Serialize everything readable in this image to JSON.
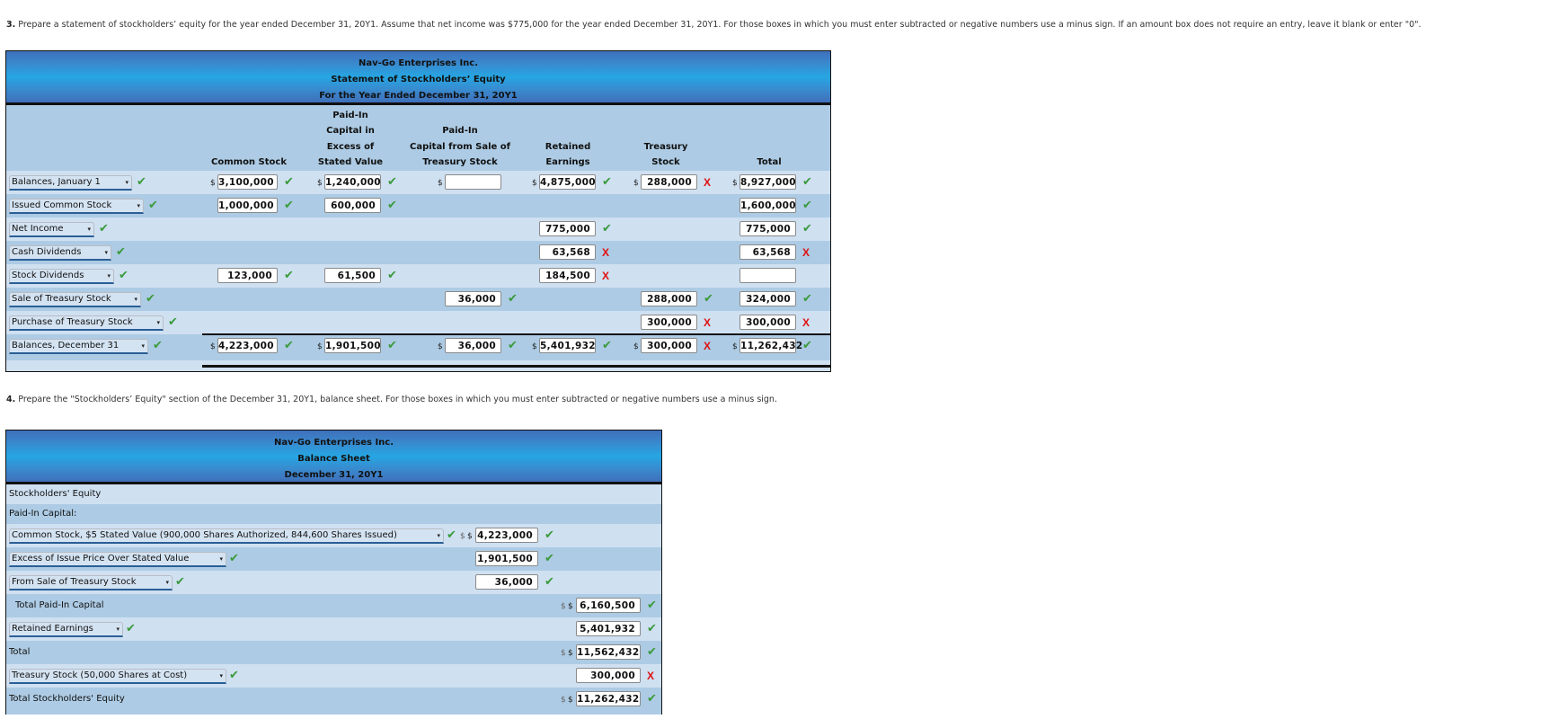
{
  "question3": {
    "number": "3.",
    "text": "Prepare a statement of stockholders’ equity for the year ended December 31, 20Y1. Assume that net income was $775,000 for the year ended December 31, 20Y1. For those boxes in which you must enter subtracted or negative numbers use a minus sign. If an amount box does not require an entry, leave it blank or enter \"0\"."
  },
  "statement": {
    "company": "Nav-Go Enterprises Inc.",
    "title": "Statement of Stockholders’ Equity",
    "period": "For the Year Ended December 31, 20Y1",
    "columns": [
      {
        "lines": [
          "Common Stock"
        ]
      },
      {
        "lines": [
          "Paid-In",
          "Capital in",
          "Excess of",
          "Stated Value"
        ]
      },
      {
        "lines": [
          "Paid-In",
          "Capital from Sale of",
          "Treasury Stock"
        ]
      },
      {
        "lines": [
          "Retained",
          "Earnings"
        ]
      },
      {
        "lines": [
          "Treasury",
          "Stock"
        ]
      },
      {
        "lines": [
          "Total"
        ]
      }
    ],
    "rows": [
      {
        "label": "Balances, January 1",
        "status": "correct",
        "cells": [
          {
            "value": "3,100,000",
            "dollar": true,
            "status": "correct"
          },
          {
            "value": "1,240,000",
            "dollar": true,
            "status": "correct"
          },
          {
            "value": "",
            "dollar": true,
            "status": ""
          },
          {
            "value": "4,875,000",
            "dollar": true,
            "status": "correct"
          },
          {
            "value": "288,000",
            "dollar": true,
            "status": "incorrect"
          },
          {
            "value": "8,927,000",
            "dollar": true,
            "status": "correct"
          }
        ]
      },
      {
        "label": "Issued Common Stock",
        "status": "correct",
        "cells": [
          {
            "value": "1,000,000",
            "status": "correct"
          },
          {
            "value": "600,000",
            "status": "correct"
          },
          null,
          null,
          null,
          {
            "value": "1,600,000",
            "status": "correct"
          }
        ]
      },
      {
        "label": "Net Income",
        "status": "correct",
        "cells": [
          null,
          null,
          null,
          {
            "value": "775,000",
            "status": "correct"
          },
          null,
          {
            "value": "775,000",
            "status": "correct"
          }
        ]
      },
      {
        "label": "Cash Dividends",
        "status": "correct",
        "cells": [
          null,
          null,
          null,
          {
            "value": "63,568",
            "status": "incorrect"
          },
          null,
          {
            "value": "63,568",
            "status": "incorrect"
          }
        ]
      },
      {
        "label": "Stock Dividends",
        "status": "correct",
        "cells": [
          {
            "value": "123,000",
            "status": "correct"
          },
          {
            "value": "61,500",
            "status": "correct"
          },
          null,
          {
            "value": "184,500",
            "status": "incorrect"
          },
          null,
          {
            "value": "",
            "status": ""
          }
        ]
      },
      {
        "label": "Sale of Treasury Stock",
        "status": "correct",
        "cells": [
          null,
          null,
          {
            "value": "36,000",
            "status": "correct"
          },
          null,
          {
            "value": "288,000",
            "status": "correct"
          },
          {
            "value": "324,000",
            "status": "correct"
          }
        ]
      },
      {
        "label": "Purchase of Treasury Stock",
        "status": "correct",
        "cells": [
          null,
          null,
          null,
          null,
          {
            "value": "300,000",
            "status": "incorrect"
          },
          {
            "value": "300,000",
            "status": "incorrect"
          }
        ]
      },
      {
        "label": "Balances, December 31",
        "status": "correct",
        "cells": [
          {
            "value": "4,223,000",
            "dollar": true,
            "status": "correct"
          },
          {
            "value": "1,901,500",
            "dollar": true,
            "status": "correct"
          },
          {
            "value": "36,000",
            "dollar": true,
            "status": "correct"
          },
          {
            "value": "5,401,932",
            "dollar": true,
            "status": "correct"
          },
          {
            "value": "300,000",
            "dollar": true,
            "status": "incorrect"
          },
          {
            "value": "11,262,432",
            "dollar": true,
            "status": "correct"
          }
        ]
      }
    ]
  },
  "question4": {
    "number": "4.",
    "text": "Prepare the \"Stockholders’ Equity\" section of the December 31, 20Y1, balance sheet. For those boxes in which you must enter subtracted or negative numbers use a minus sign."
  },
  "balance_sheet": {
    "company": "Nav-Go Enterprises Inc.",
    "title": "Balance Sheet",
    "date": "December 31, 20Y1",
    "rows": [
      {
        "type": "text",
        "label": "Stockholders' Equity"
      },
      {
        "type": "text",
        "label": "Paid-In Capital:"
      },
      {
        "type": "select",
        "label": "Common Stock, $5 Stated Value (900,000 Shares Authorized, 844,600 Shares Issued)",
        "status": "correct",
        "col": 1,
        "value": "4,223,000",
        "dollar": true,
        "value_status": "correct"
      },
      {
        "type": "select",
        "label": "Excess of Issue Price Over Stated Value",
        "status": "correct",
        "col": 1,
        "value": "1,901,500",
        "value_status": "correct"
      },
      {
        "type": "select",
        "label": "From Sale of Treasury Stock",
        "status": "correct",
        "col": 1,
        "value": "36,000",
        "value_status": "correct"
      },
      {
        "type": "text",
        "label": "Total Paid-In Capital",
        "indent": true,
        "col": 2,
        "value": "6,160,500",
        "dollar": true,
        "value_status": "correct"
      },
      {
        "type": "select",
        "label": "Retained Earnings",
        "status": "correct",
        "col": 2,
        "value": "5,401,932",
        "value_status": "correct"
      },
      {
        "type": "text",
        "label": "Total",
        "col": 2,
        "value": "11,562,432",
        "dollar": true,
        "value_status": "correct"
      },
      {
        "type": "select",
        "label": "Treasury Stock (50,000 Shares at Cost)",
        "status": "correct",
        "col": 2,
        "value": "300,000",
        "value_status": "incorrect"
      },
      {
        "type": "text",
        "label": "Total Stockholders' Equity",
        "col": 2,
        "value": "11,262,432",
        "dollar": true,
        "value_status": "correct"
      }
    ]
  },
  "glyphs": {
    "check": "✔",
    "cross": "X",
    "dollar": "$",
    "arrow": "▾"
  }
}
